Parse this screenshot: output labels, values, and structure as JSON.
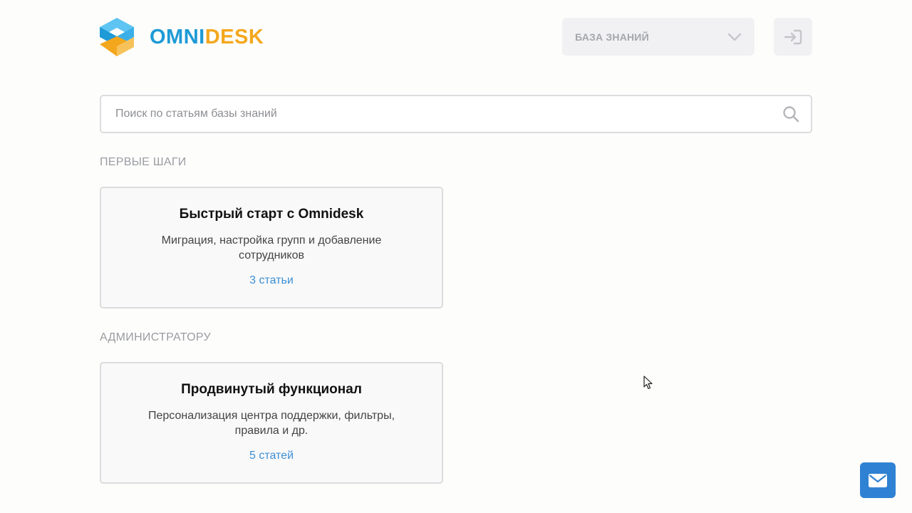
{
  "header": {
    "logo": {
      "text_part1": "OMNI",
      "text_part2": "DESK",
      "color_part1": "#1e9ad6",
      "color_part2": "#f4a71d"
    },
    "kb_selector": {
      "label": "БАЗА ЗНАНИЙ",
      "icon": "chevron-down-icon"
    },
    "login_button": {
      "icon": "sign-in-icon"
    }
  },
  "search": {
    "placeholder": "Поиск по статьям базы знаний",
    "value": "",
    "icon": "search-icon"
  },
  "sections": [
    {
      "title": "ПЕРВЫЕ ШАГИ",
      "cards": [
        {
          "title": "Быстрый старт с Omnidesk",
          "description": "Миграция, настройка групп и добавление сотрудников",
          "count": "3 статьи"
        }
      ]
    },
    {
      "title": "АДМИНИСТРАТОРУ",
      "cards": [
        {
          "title": "Продвинутый функционал",
          "description": "Персонализация центра поддержки, фильтры, правила и др.",
          "count": "5 статей"
        }
      ]
    }
  ],
  "contact_button": {
    "icon": "envelope-icon",
    "color": "#2f82d3"
  },
  "colors": {
    "accent": "#3c8fd3",
    "border": "#dcdcde",
    "muted_text": "#9a9ca1"
  }
}
